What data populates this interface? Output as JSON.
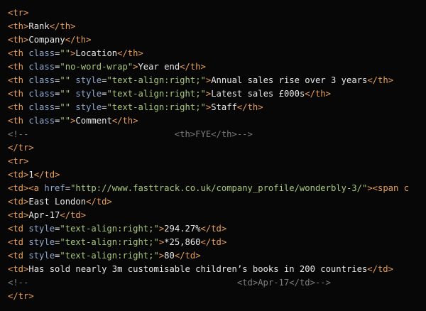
{
  "colors": {
    "background": "#070707",
    "tag": "#e8a05a",
    "attribute": "#8fa8cf",
    "string": "#a8c77a",
    "text": "#e8e8e8",
    "comment": "#7d7d7d"
  },
  "lines": [
    [
      {
        "t": "tag",
        "v": "<tr>"
      }
    ],
    [
      {
        "t": "tag",
        "v": "<th>"
      },
      {
        "t": "txt",
        "v": "Rank"
      },
      {
        "t": "tag",
        "v": "</th>"
      }
    ],
    [
      {
        "t": "tag",
        "v": "<th>"
      },
      {
        "t": "txt",
        "v": "Company"
      },
      {
        "t": "tag",
        "v": "</th>"
      }
    ],
    [
      {
        "t": "tag",
        "v": "<th "
      },
      {
        "t": "attr",
        "v": "class"
      },
      {
        "t": "txt",
        "v": "="
      },
      {
        "t": "str",
        "v": "\"\""
      },
      {
        "t": "tag",
        "v": ">"
      },
      {
        "t": "txt",
        "v": "Location"
      },
      {
        "t": "tag",
        "v": "</th>"
      }
    ],
    [
      {
        "t": "tag",
        "v": "<th "
      },
      {
        "t": "attr",
        "v": "class"
      },
      {
        "t": "txt",
        "v": "="
      },
      {
        "t": "str",
        "v": "\"no-word-wrap\""
      },
      {
        "t": "tag",
        "v": ">"
      },
      {
        "t": "txt",
        "v": "Year end"
      },
      {
        "t": "tag",
        "v": "</th>"
      }
    ],
    [
      {
        "t": "tag",
        "v": "<th "
      },
      {
        "t": "attr",
        "v": "class"
      },
      {
        "t": "txt",
        "v": "="
      },
      {
        "t": "str",
        "v": "\"\""
      },
      {
        "t": "txt",
        "v": " "
      },
      {
        "t": "attr",
        "v": "style"
      },
      {
        "t": "txt",
        "v": "="
      },
      {
        "t": "str",
        "v": "\"text-align:right;\""
      },
      {
        "t": "tag",
        "v": ">"
      },
      {
        "t": "txt",
        "v": "Annual sales rise over 3 years"
      },
      {
        "t": "tag",
        "v": "</th>"
      }
    ],
    [
      {
        "t": "tag",
        "v": "<th "
      },
      {
        "t": "attr",
        "v": "class"
      },
      {
        "t": "txt",
        "v": "="
      },
      {
        "t": "str",
        "v": "\"\""
      },
      {
        "t": "txt",
        "v": " "
      },
      {
        "t": "attr",
        "v": "style"
      },
      {
        "t": "txt",
        "v": "="
      },
      {
        "t": "str",
        "v": "\"text-align:right;\""
      },
      {
        "t": "tag",
        "v": ">"
      },
      {
        "t": "txt",
        "v": "Latest sales £000s"
      },
      {
        "t": "tag",
        "v": "</th>"
      }
    ],
    [
      {
        "t": "tag",
        "v": "<th "
      },
      {
        "t": "attr",
        "v": "class"
      },
      {
        "t": "txt",
        "v": "="
      },
      {
        "t": "str",
        "v": "\"\""
      },
      {
        "t": "txt",
        "v": " "
      },
      {
        "t": "attr",
        "v": "style"
      },
      {
        "t": "txt",
        "v": "="
      },
      {
        "t": "str",
        "v": "\"text-align:right;\""
      },
      {
        "t": "tag",
        "v": ">"
      },
      {
        "t": "txt",
        "v": "Staff"
      },
      {
        "t": "tag",
        "v": "</th>"
      }
    ],
    [
      {
        "t": "tag",
        "v": "<th "
      },
      {
        "t": "attr",
        "v": "class"
      },
      {
        "t": "txt",
        "v": "="
      },
      {
        "t": "str",
        "v": "\"\""
      },
      {
        "t": "tag",
        "v": ">"
      },
      {
        "t": "txt",
        "v": "Comment"
      },
      {
        "t": "tag",
        "v": "</th>"
      }
    ],
    [
      {
        "t": "cmt",
        "v": "<!--                            <th>FYE</th>-->"
      }
    ],
    [
      {
        "t": "tag",
        "v": "</tr>"
      }
    ],
    [
      {
        "t": "tag",
        "v": "<tr>"
      }
    ],
    [
      {
        "t": "tag",
        "v": "<td>"
      },
      {
        "t": "txt",
        "v": "1"
      },
      {
        "t": "tag",
        "v": "</td>"
      }
    ],
    [
      {
        "t": "tag",
        "v": "<td><a "
      },
      {
        "t": "attr",
        "v": "href"
      },
      {
        "t": "txt",
        "v": "="
      },
      {
        "t": "str",
        "v": "\"http://www.fasttrack.co.uk/company_profile/wonderbly-3/\""
      },
      {
        "t": "tag",
        "v": "><span c"
      }
    ],
    [
      {
        "t": "tag",
        "v": "<td>"
      },
      {
        "t": "txt",
        "v": "East London"
      },
      {
        "t": "tag",
        "v": "</td>"
      }
    ],
    [
      {
        "t": "tag",
        "v": "<td>"
      },
      {
        "t": "txt",
        "v": "Apr-17"
      },
      {
        "t": "tag",
        "v": "</td>"
      }
    ],
    [
      {
        "t": "tag",
        "v": "<td "
      },
      {
        "t": "attr",
        "v": "style"
      },
      {
        "t": "txt",
        "v": "="
      },
      {
        "t": "str",
        "v": "\"text-align:right;\""
      },
      {
        "t": "tag",
        "v": ">"
      },
      {
        "t": "txt",
        "v": "294.27%"
      },
      {
        "t": "tag",
        "v": "</td>"
      }
    ],
    [
      {
        "t": "tag",
        "v": "<td "
      },
      {
        "t": "attr",
        "v": "style"
      },
      {
        "t": "txt",
        "v": "="
      },
      {
        "t": "str",
        "v": "\"text-align:right;\""
      },
      {
        "t": "tag",
        "v": ">"
      },
      {
        "t": "txt",
        "v": "*25,860"
      },
      {
        "t": "tag",
        "v": "</td>"
      }
    ],
    [
      {
        "t": "tag",
        "v": "<td "
      },
      {
        "t": "attr",
        "v": "style"
      },
      {
        "t": "txt",
        "v": "="
      },
      {
        "t": "str",
        "v": "\"text-align:right;\""
      },
      {
        "t": "tag",
        "v": ">"
      },
      {
        "t": "txt",
        "v": "80"
      },
      {
        "t": "tag",
        "v": "</td>"
      }
    ],
    [
      {
        "t": "tag",
        "v": "<td>"
      },
      {
        "t": "txt",
        "v": "Has sold nearly 3m customisable children’s books in 200 countries"
      },
      {
        "t": "tag",
        "v": "</td>"
      }
    ],
    [
      {
        "t": "cmt",
        "v": "<!--                                        <td>Apr-17</td>-->"
      }
    ],
    [
      {
        "t": "tag",
        "v": "</tr>"
      }
    ]
  ]
}
